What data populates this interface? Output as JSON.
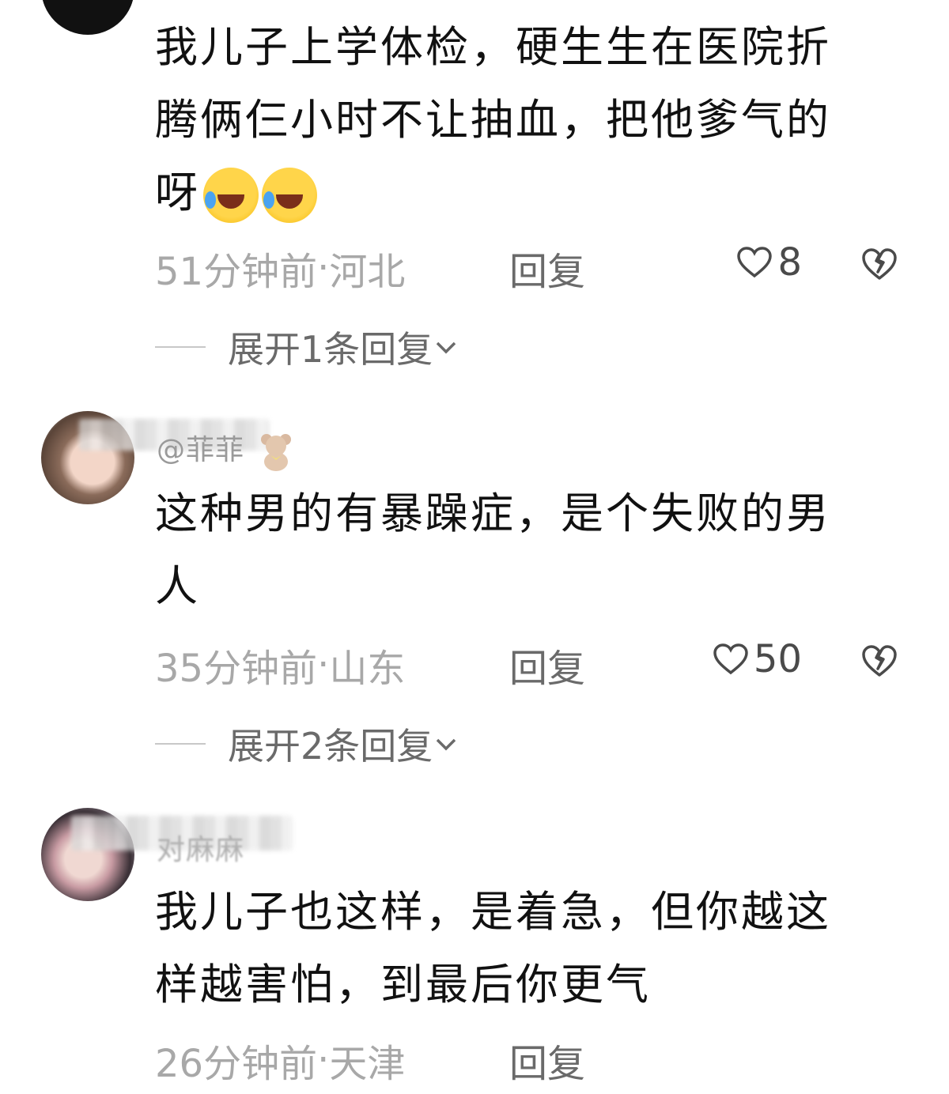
{
  "comments": [
    {
      "text_line1": "我儿子上学体检，硬生生在医院折",
      "text_line2": "腾俩仨小时不让抽血，把他爹气的",
      "text_line3": "呀",
      "emojis": [
        "crying-laughing-icon",
        "crying-laughing-icon"
      ],
      "time": "51分钟前",
      "location": "河北",
      "reply_label": "回复",
      "likes": "8",
      "expand_label": "展开1条回复"
    },
    {
      "username": "@菲菲",
      "text_line1": "这种男的有暴躁症，是个失败的男",
      "text_line2": "人",
      "time": "35分钟前",
      "location": "山东",
      "reply_label": "回复",
      "likes": "50",
      "expand_label": "展开2条回复"
    },
    {
      "username": "对麻麻",
      "text_line1": "我儿子也这样，是着急，但你越这",
      "text_line2": "样越害怕，到最后你更气",
      "time": "26分钟前",
      "location": "天津",
      "reply_label": "回复"
    }
  ],
  "meta_separator": " · ",
  "colors": {
    "text": "#111111",
    "meta": "#a8a8a8",
    "action": "#6a6a6a",
    "emoji": "#ffd54a"
  }
}
